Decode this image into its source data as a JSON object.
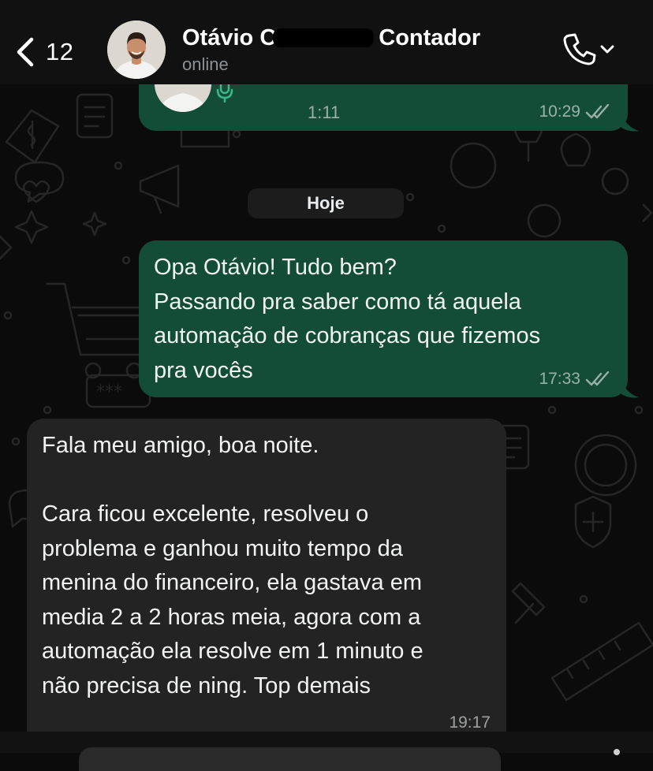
{
  "header": {
    "back_count": "12",
    "contact_name_first": "Otávio",
    "contact_name_initial": "C",
    "contact_name_last": "Contador",
    "status": "online"
  },
  "messages": {
    "audio": {
      "duration": "1:11",
      "time": "10:29",
      "read": true
    },
    "date_divider": "Hoje",
    "outgoing": {
      "text": "Opa Otávio! Tudo bem?\nPassando pra saber como tá aquela\nautomação de cobranças que fizemos\npra vocês",
      "time": "17:33",
      "read": true
    },
    "incoming": {
      "text": "Fala meu amigo, boa noite.\n\nCara ficou excelente, resolveu o\nproblema e ganhou muito tempo da\nmenina do financeiro, ela gastava em\nmedia 2 a 2 horas meia, agora com a\nautomação ela resolve em 1 minuto e\nnão precisa de ning. Top demais",
      "time": "19:17"
    }
  },
  "colors": {
    "outgoing_bubble": "#134d37",
    "incoming_bubble": "#232323",
    "header_bg": "#111111",
    "chat_bg": "#0b0b0b"
  },
  "icons": {
    "back": "chevron-left-icon",
    "call": "phone-icon",
    "call_menu": "chevron-down-icon",
    "read_receipt": "double-check-icon",
    "microphone": "microphone-icon"
  }
}
